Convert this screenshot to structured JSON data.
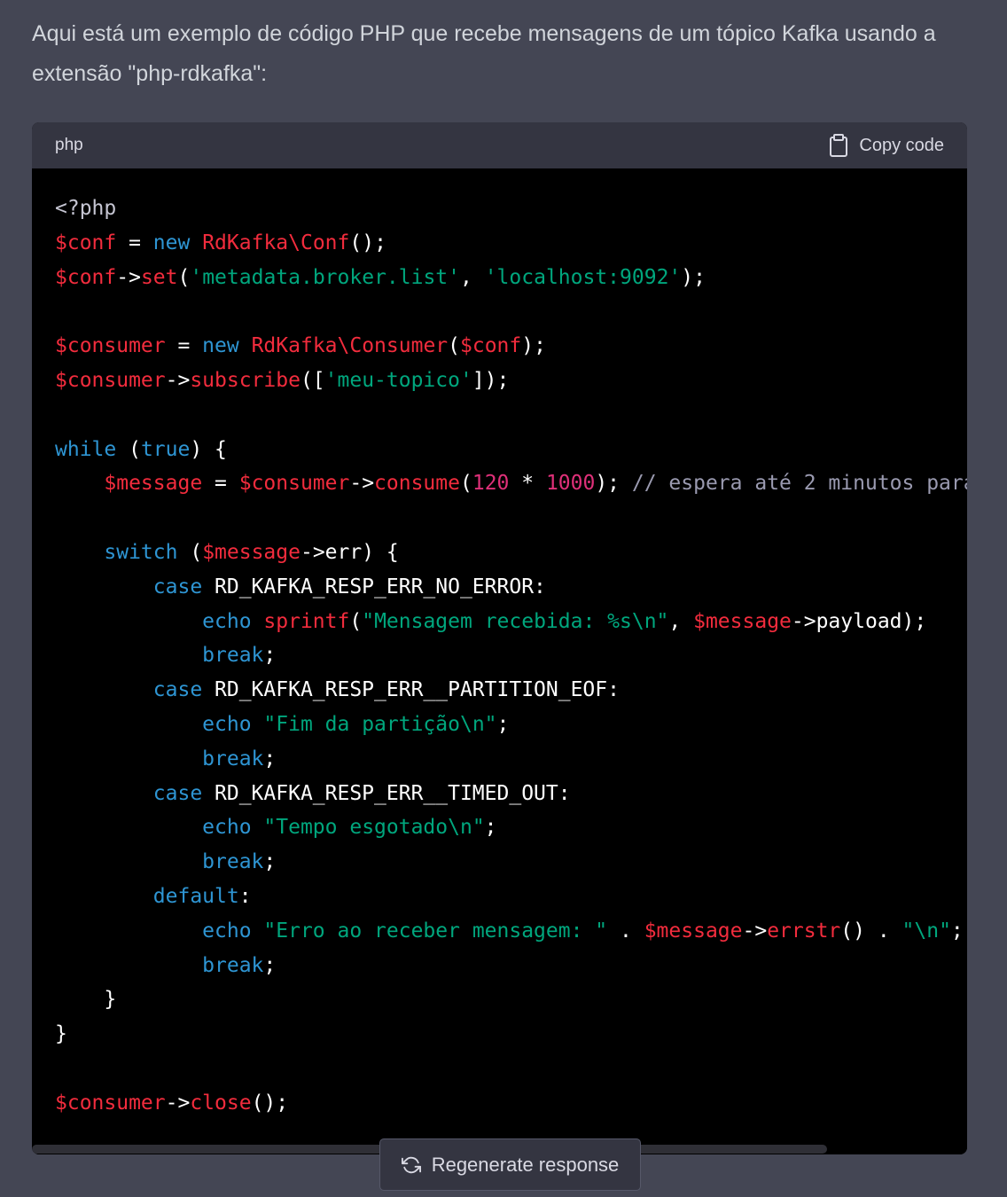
{
  "message": {
    "intro": "Aqui está um exemplo de código PHP que recebe mensagens de um tópico Kafka usando a extensão \"php-rdkafka\":"
  },
  "code_block": {
    "language": "php",
    "copy_label": "Copy code",
    "lines": [
      [
        [
          "meta",
          "<?php"
        ]
      ],
      [
        [
          "var",
          "$conf"
        ],
        [
          "plain",
          " = "
        ],
        [
          "kw",
          "new"
        ],
        [
          "plain",
          " "
        ],
        [
          "cls",
          "RdKafka\\Conf"
        ],
        [
          "plain",
          "();"
        ]
      ],
      [
        [
          "var",
          "$conf"
        ],
        [
          "plain",
          "->"
        ],
        [
          "func",
          "set"
        ],
        [
          "plain",
          "("
        ],
        [
          "str",
          "'metadata.broker.list'"
        ],
        [
          "plain",
          ", "
        ],
        [
          "str",
          "'localhost:9092'"
        ],
        [
          "plain",
          ");"
        ]
      ],
      [],
      [
        [
          "var",
          "$consumer"
        ],
        [
          "plain",
          " = "
        ],
        [
          "kw",
          "new"
        ],
        [
          "plain",
          " "
        ],
        [
          "cls",
          "RdKafka\\Consumer"
        ],
        [
          "plain",
          "("
        ],
        [
          "var",
          "$conf"
        ],
        [
          "plain",
          ");"
        ]
      ],
      [
        [
          "var",
          "$consumer"
        ],
        [
          "plain",
          "->"
        ],
        [
          "func",
          "subscribe"
        ],
        [
          "plain",
          "(["
        ],
        [
          "str",
          "'meu-topico'"
        ],
        [
          "plain",
          "]);"
        ]
      ],
      [],
      [
        [
          "kw",
          "while"
        ],
        [
          "plain",
          " ("
        ],
        [
          "kw",
          "true"
        ],
        [
          "plain",
          ") {"
        ]
      ],
      [
        [
          "plain",
          "    "
        ],
        [
          "var",
          "$message"
        ],
        [
          "plain",
          " = "
        ],
        [
          "var",
          "$consumer"
        ],
        [
          "plain",
          "->"
        ],
        [
          "func",
          "consume"
        ],
        [
          "plain",
          "("
        ],
        [
          "num",
          "120"
        ],
        [
          "plain",
          " * "
        ],
        [
          "num",
          "1000"
        ],
        [
          "plain",
          "); "
        ],
        [
          "cmt",
          "// espera até 2 minutos para"
        ]
      ],
      [],
      [
        [
          "plain",
          "    "
        ],
        [
          "kw",
          "switch"
        ],
        [
          "plain",
          " ("
        ],
        [
          "var",
          "$message"
        ],
        [
          "plain",
          "->err) {"
        ]
      ],
      [
        [
          "plain",
          "        "
        ],
        [
          "kw",
          "case"
        ],
        [
          "plain",
          " RD_KAFKA_RESP_ERR_NO_ERROR:"
        ]
      ],
      [
        [
          "plain",
          "            "
        ],
        [
          "kw",
          "echo"
        ],
        [
          "plain",
          " "
        ],
        [
          "func",
          "sprintf"
        ],
        [
          "plain",
          "("
        ],
        [
          "str",
          "\"Mensagem recebida: %s\\n\""
        ],
        [
          "plain",
          ", "
        ],
        [
          "var",
          "$message"
        ],
        [
          "plain",
          "->payload);"
        ]
      ],
      [
        [
          "plain",
          "            "
        ],
        [
          "kw",
          "break"
        ],
        [
          "plain",
          ";"
        ]
      ],
      [
        [
          "plain",
          "        "
        ],
        [
          "kw",
          "case"
        ],
        [
          "plain",
          " RD_KAFKA_RESP_ERR__PARTITION_EOF:"
        ]
      ],
      [
        [
          "plain",
          "            "
        ],
        [
          "kw",
          "echo"
        ],
        [
          "plain",
          " "
        ],
        [
          "str",
          "\"Fim da partição\\n\""
        ],
        [
          "plain",
          ";"
        ]
      ],
      [
        [
          "plain",
          "            "
        ],
        [
          "kw",
          "break"
        ],
        [
          "plain",
          ";"
        ]
      ],
      [
        [
          "plain",
          "        "
        ],
        [
          "kw",
          "case"
        ],
        [
          "plain",
          " RD_KAFKA_RESP_ERR__TIMED_OUT:"
        ]
      ],
      [
        [
          "plain",
          "            "
        ],
        [
          "kw",
          "echo"
        ],
        [
          "plain",
          " "
        ],
        [
          "str",
          "\"Tempo esgotado\\n\""
        ],
        [
          "plain",
          ";"
        ]
      ],
      [
        [
          "plain",
          "            "
        ],
        [
          "kw",
          "break"
        ],
        [
          "plain",
          ";"
        ]
      ],
      [
        [
          "plain",
          "        "
        ],
        [
          "kw",
          "default"
        ],
        [
          "plain",
          ":"
        ]
      ],
      [
        [
          "plain",
          "            "
        ],
        [
          "kw",
          "echo"
        ],
        [
          "plain",
          " "
        ],
        [
          "str",
          "\"Erro ao receber mensagem: \""
        ],
        [
          "plain",
          " . "
        ],
        [
          "var",
          "$message"
        ],
        [
          "plain",
          "->"
        ],
        [
          "func",
          "errstr"
        ],
        [
          "plain",
          "() . "
        ],
        [
          "str",
          "\"\\n\""
        ],
        [
          "plain",
          ";"
        ]
      ],
      [
        [
          "plain",
          "            "
        ],
        [
          "kw",
          "break"
        ],
        [
          "plain",
          ";"
        ]
      ],
      [
        [
          "plain",
          "    }"
        ]
      ],
      [
        [
          "plain",
          "}"
        ]
      ],
      [],
      [
        [
          "var",
          "$consumer"
        ],
        [
          "plain",
          "->"
        ],
        [
          "func",
          "close"
        ],
        [
          "plain",
          "();"
        ]
      ]
    ],
    "scroll_fraction": 0.85
  },
  "regenerate": {
    "label": "Regenerate response"
  },
  "icons": {
    "copy": "clipboard-icon",
    "regenerate": "refresh-icon"
  },
  "colors": {
    "page_bg": "#444654",
    "code_bg": "#000000",
    "header_bg": "#343541",
    "keyword": "#2e95d3",
    "variable": "#f22c3d",
    "string": "#00a67d",
    "number": "#df3079",
    "comment": "#9a9ab0"
  }
}
